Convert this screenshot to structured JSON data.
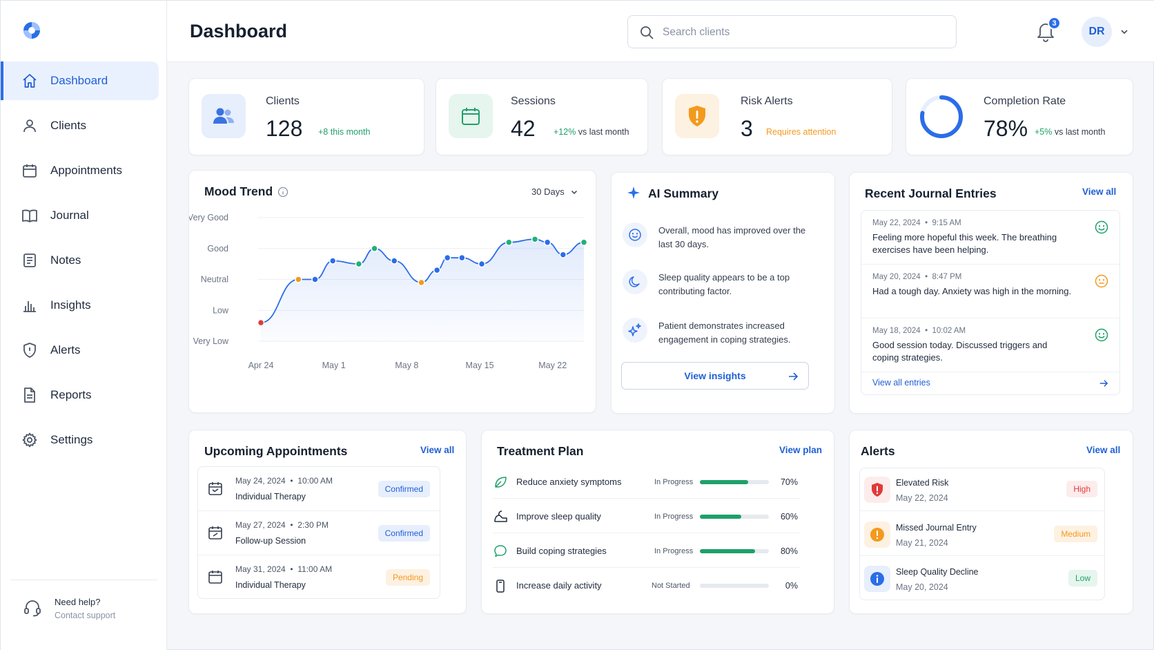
{
  "colors": {
    "accent": "#2b6de8",
    "green": "#1ea06a",
    "orange": "#f39a1d",
    "red": "#e03a3a"
  },
  "header": {
    "title": "Dashboard",
    "search_placeholder": "Search clients",
    "notification_count": "3",
    "avatar_initials": "DR"
  },
  "sidebar": {
    "items": [
      {
        "label": "Dashboard",
        "icon": "home-icon",
        "active": true
      },
      {
        "label": "Clients",
        "icon": "user-icon"
      },
      {
        "label": "Appointments",
        "icon": "calendar-icon"
      },
      {
        "label": "Journal",
        "icon": "book-icon"
      },
      {
        "label": "Notes",
        "icon": "note-icon"
      },
      {
        "label": "Insights",
        "icon": "bar-chart-icon"
      },
      {
        "label": "Alerts",
        "icon": "shield-alert-icon"
      },
      {
        "label": "Reports",
        "icon": "document-icon"
      },
      {
        "label": "Settings",
        "icon": "gear-icon"
      }
    ],
    "help": {
      "title": "Need help?",
      "subtitle": "Contact support"
    }
  },
  "stats": [
    {
      "label": "Clients",
      "value": "128",
      "sub": "+8 this month",
      "sub_color": "#1ea06a"
    },
    {
      "label": "Sessions",
      "value": "42",
      "sub_prefix": "+12%",
      "sub": " vs last month",
      "sub_color": "#1ea06a"
    },
    {
      "label": "Risk Alerts",
      "value": "3",
      "sub": "Requires attention",
      "sub_color": "#f39a1d"
    },
    {
      "label": "Completion Rate",
      "value": "78%",
      "sub_prefix": "+5%",
      "sub": " vs last month",
      "sub_color": "#1ea06a",
      "ring_fraction": 0.78
    }
  ],
  "mood": {
    "title": "Mood Trend",
    "range": "30 Days"
  },
  "chart_data": {
    "type": "line",
    "y_categories": [
      "Very Low",
      "Low",
      "Neutral",
      "Good",
      "Very Good"
    ],
    "ylim": [
      0,
      4
    ],
    "x_ticks": [
      "Apr 24",
      "May 1",
      "May 8",
      "May 15",
      "May 22"
    ],
    "x_tick_days": [
      0,
      7,
      14,
      21,
      28
    ],
    "xlim": [
      0,
      31
    ],
    "points": [
      {
        "d": 0,
        "v": 0.6,
        "c": "red"
      },
      {
        "d": 3.6,
        "v": 2.0,
        "c": "orange"
      },
      {
        "d": 5.2,
        "v": 2.0,
        "c": "blue"
      },
      {
        "d": 6.9,
        "v": 2.6,
        "c": "blue"
      },
      {
        "d": 9.4,
        "v": 2.5,
        "c": "green"
      },
      {
        "d": 10.9,
        "v": 3.0,
        "c": "green"
      },
      {
        "d": 12.8,
        "v": 2.6,
        "c": "blue"
      },
      {
        "d": 15.4,
        "v": 1.9,
        "c": "orange"
      },
      {
        "d": 16.9,
        "v": 2.3,
        "c": "blue"
      },
      {
        "d": 17.9,
        "v": 2.7,
        "c": "blue"
      },
      {
        "d": 19.3,
        "v": 2.7,
        "c": "blue"
      },
      {
        "d": 21.2,
        "v": 2.5,
        "c": "blue"
      },
      {
        "d": 23.8,
        "v": 3.2,
        "c": "green"
      },
      {
        "d": 26.3,
        "v": 3.3,
        "c": "green"
      },
      {
        "d": 27.5,
        "v": 3.2,
        "c": "blue"
      },
      {
        "d": 29.0,
        "v": 2.8,
        "c": "blue"
      },
      {
        "d": 31.0,
        "v": 3.2,
        "c": "green"
      }
    ]
  },
  "ai_summary": {
    "title": "AI Summary",
    "items": [
      {
        "icon": "smile-icon",
        "text": "Overall, mood has improved over the last 30 days."
      },
      {
        "icon": "moon-icon",
        "text": "Sleep quality appears to be a top contributing factor."
      },
      {
        "icon": "sparkle-icon",
        "text": "Patient demonstrates increased engagement in coping strategies."
      }
    ],
    "button": "View insights"
  },
  "journal": {
    "title": "Recent Journal Entries",
    "view_all": "View all",
    "entries": [
      {
        "date": "May 22, 2024",
        "time": "9:15 AM",
        "text": "Feeling more hopeful this week. The breathing exercises have been helping.",
        "mood_color": "#1ea06a"
      },
      {
        "date": "May 20, 2024",
        "time": "8:47 PM",
        "text": "Had a tough day. Anxiety was high in the morning.",
        "mood_color": "#f39a1d"
      },
      {
        "date": "May 18, 2024",
        "time": "10:02 AM",
        "text": "Good session today. Discussed triggers and coping strategies.",
        "mood_color": "#1ea06a"
      }
    ],
    "footer": "View all entries"
  },
  "appointments": {
    "title": "Upcoming Appointments",
    "view_all": "View all",
    "items": [
      {
        "date": "May 24, 2024",
        "time": "10:00 AM",
        "type": "Individual Therapy",
        "status": "Confirmed",
        "kind": "confirmed"
      },
      {
        "date": "May 27, 2024",
        "time": "2:30 PM",
        "type": "Follow-up Session",
        "status": "Confirmed",
        "kind": "confirmed"
      },
      {
        "date": "May 31, 2024",
        "time": "11:00 AM",
        "type": "Individual Therapy",
        "status": "Pending",
        "kind": "pending"
      }
    ]
  },
  "treatment": {
    "title": "Treatment Plan",
    "view_plan": "View plan",
    "goals": [
      {
        "goal": "Reduce anxiety symptoms",
        "status": "In Progress",
        "progress": 70,
        "pct": "70%",
        "icon": "leaf-icon"
      },
      {
        "goal": "Improve sleep quality",
        "status": "In Progress",
        "progress": 60,
        "pct": "60%",
        "icon": "bed-icon"
      },
      {
        "goal": "Build coping strategies",
        "status": "In Progress",
        "progress": 80,
        "pct": "80%",
        "icon": "chat-icon"
      },
      {
        "goal": "Increase daily activity",
        "status": "Not Started",
        "progress": 0,
        "pct": "0%",
        "icon": "phone-icon"
      }
    ]
  },
  "alerts": {
    "title": "Alerts",
    "view_all": "View all",
    "items": [
      {
        "name": "Elevated Risk",
        "date": "May 22, 2024",
        "level": "High",
        "kind": "high"
      },
      {
        "name": "Missed Journal Entry",
        "date": "May 21, 2024",
        "level": "Medium",
        "kind": "medium"
      },
      {
        "name": "Sleep Quality Decline",
        "date": "May 20, 2024",
        "level": "Low",
        "kind": "low"
      }
    ]
  }
}
